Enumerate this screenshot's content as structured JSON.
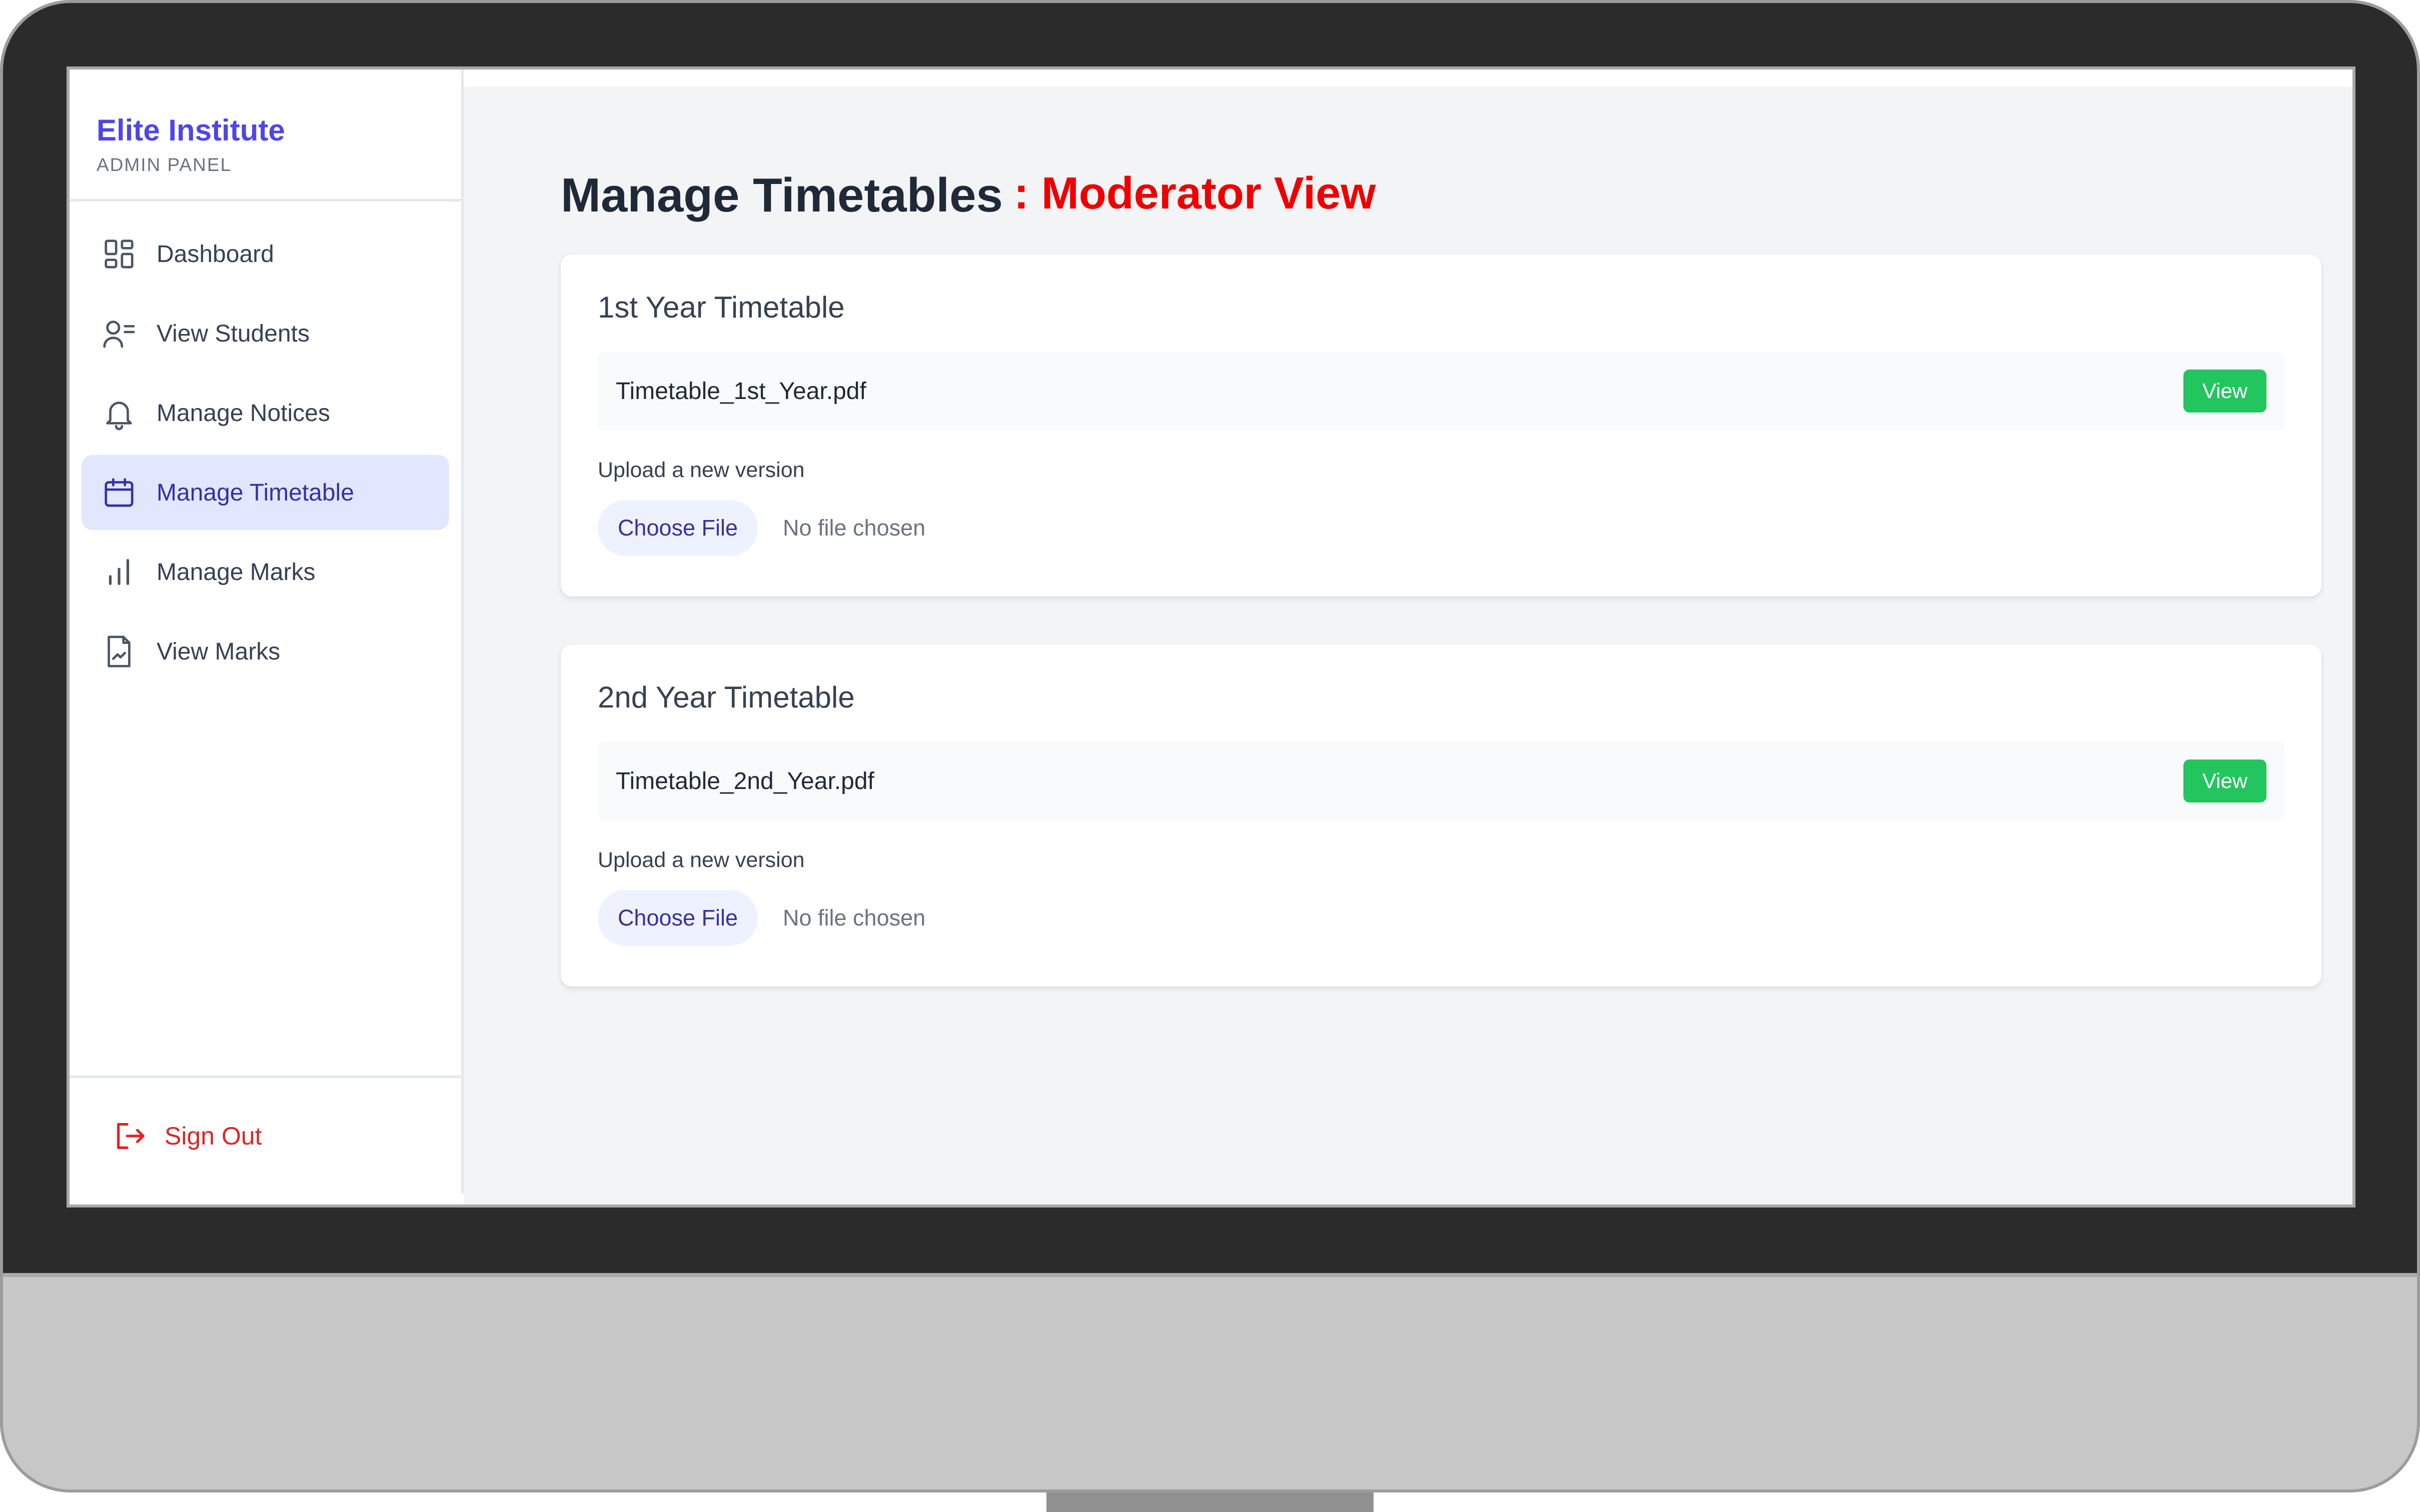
{
  "brand": {
    "title": "Elite Institute",
    "subtitle": "ADMIN PANEL",
    "color": "#4f46e5"
  },
  "sidebar": {
    "items": [
      {
        "label": "Dashboard",
        "icon": "dashboard-grid-icon",
        "active": false
      },
      {
        "label": "View Students",
        "icon": "user-list-icon",
        "active": false
      },
      {
        "label": "Manage Notices",
        "icon": "bell-icon",
        "active": false
      },
      {
        "label": "Manage Timetable",
        "icon": "calendar-icon",
        "active": true
      },
      {
        "label": "Manage Marks",
        "icon": "bar-chart-icon",
        "active": false
      },
      {
        "label": "View Marks",
        "icon": "document-image-icon",
        "active": false
      }
    ],
    "signout": {
      "label": "Sign Out",
      "icon": "sign-out-icon",
      "color": "#dc2626"
    }
  },
  "page": {
    "title": "Manage Timetables",
    "accent": ": Moderator View",
    "accent_color": "#ee0000"
  },
  "cards": [
    {
      "title": "1st Year Timetable",
      "file_name": "Timetable_1st_Year.pdf",
      "view_label": "View",
      "upload_label": "Upload a new version",
      "choose_label": "Choose File",
      "no_file_text": "No file chosen"
    },
    {
      "title": "2nd Year Timetable",
      "file_name": "Timetable_2nd_Year.pdf",
      "view_label": "View",
      "upload_label": "Upload a new version",
      "choose_label": "Choose File",
      "no_file_text": "No file chosen"
    }
  ],
  "colors": {
    "view_button": "#22c55e",
    "active_nav_bg": "#e0e7ff",
    "main_bg": "#f3f4f6"
  }
}
